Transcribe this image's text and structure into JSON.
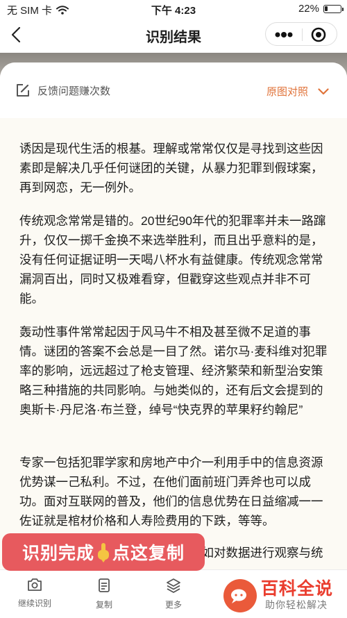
{
  "status_bar": {
    "carrier": "无 SIM 卡",
    "time": "下午 4:23",
    "battery_text": "22%",
    "battery_level": 0.22
  },
  "nav": {
    "title": "识别结果"
  },
  "result_header": {
    "feedback_label": "反馈问题赚次数",
    "original_label": "原图对照"
  },
  "paragraphs": [
    "诱因是现代生活的根基。理解或常常仅仅是寻找到这些因素即是解决几乎任何谜团的关键，从暴力犯罪到假球案，再到网恋，无一例外。",
    "传统观念常常是错的。20世纪90年代的犯罪率并未一路蹿升，仅仅一掷千金换不来选举胜利，而且出乎意料的是，没有任何证据证明一天喝八杯水有益健康。传统观念常常漏洞百出，同时又极难看穿，但戳穿这些观点并非不可能。",
    "轰动性事件常常起因于风马牛不相及甚至微不足道的事情。谜团的答案不会总是一目了然。诺尔马·麦科维对犯罪率的影响，远远超过了枪支管理、经济繁荣和新型治安策略三种措施的共同影响。与她类似的，还有后文会提到的奥斯卡·丹尼洛·布兰登，绰号“快克界的苹果籽约翰尼”",
    "专家一包括犯罪学家和房地产中介一利用手中的信息资源优势谋一己私利。不过，在他们面前班门弄斧也可以成功。面对互联网的普及，他们的信息优势在日益缩减一一佐证就是棺材价格和人寿险费用的下跌，等等。",
    "有助于理清这个纷繁复杂的世界，如对数据进行观察与统计，某些以"
  ],
  "bottom_tabs": [
    {
      "label": "继续识别",
      "icon": "camera-icon"
    },
    {
      "label": "复制",
      "icon": "copy-icon"
    },
    {
      "label": "更多",
      "icon": "layers-icon"
    }
  ],
  "promo": {
    "left_text_1": "识别完成",
    "left_text_2": "点这复制",
    "brand": "百科全说",
    "slogan": "助你轻松解决"
  }
}
